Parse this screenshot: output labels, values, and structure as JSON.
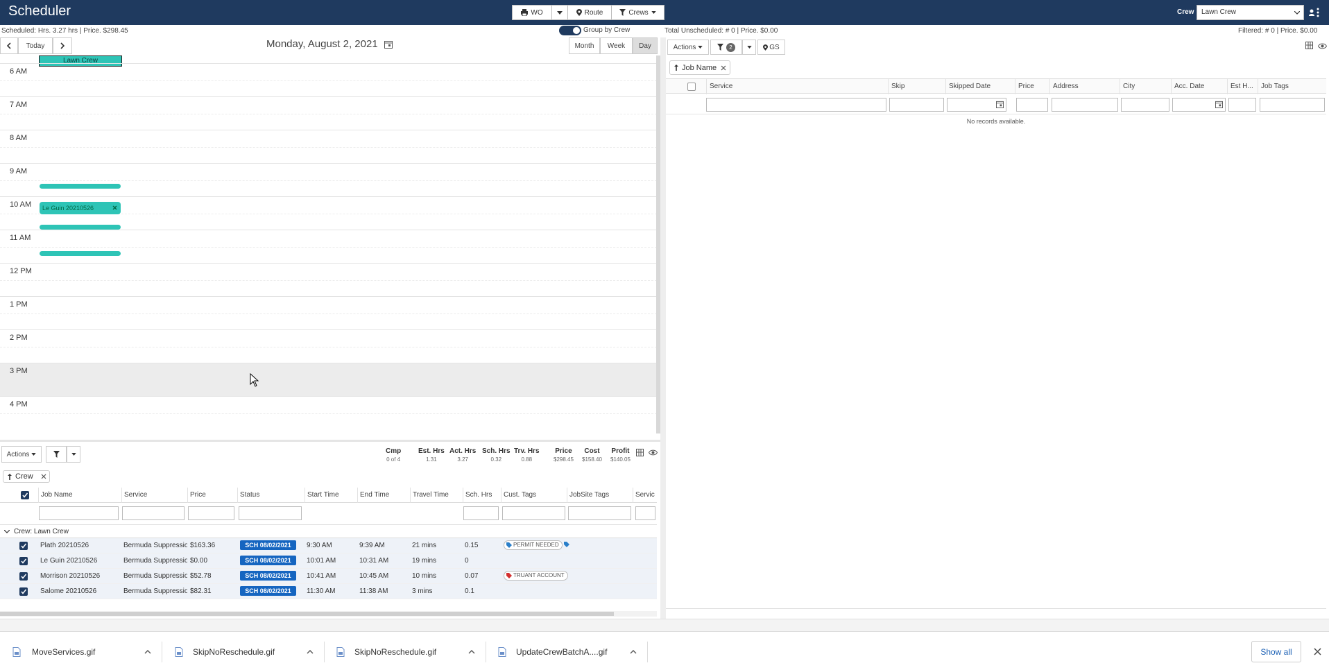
{
  "app_title": "Scheduler",
  "toolbar": {
    "wo": "WO",
    "route": "Route",
    "crews": "Crews",
    "crew_label": "Crew",
    "crew_value": "Lawn Crew"
  },
  "summary_left": "Scheduled:  Hrs. 3.27 hrs   |   Price. $298.45",
  "group_by_crew": "Group by Crew",
  "summary_right_mid": "Total Unscheduled:  # 0   |   Price. $0.00",
  "summary_right_end": "Filtered:  # 0   |   Price. $0.00",
  "calendar": {
    "today": "Today",
    "date": "Monday, August 2, 2021",
    "views": [
      "Month",
      "Week",
      "Day"
    ],
    "crew_header": "Lawn Crew",
    "hours": [
      "6 AM",
      "7 AM",
      "8 AM",
      "9 AM",
      "10 AM",
      "11 AM",
      "12 PM",
      "1 PM",
      "2 PM",
      "3 PM",
      "4 PM"
    ],
    "event_label": "Le Guin 20210526"
  },
  "bottom": {
    "actions": "Actions",
    "stats": [
      {
        "label": "Cmp",
        "value": "0 of 4"
      },
      {
        "label": "Est. Hrs",
        "value": "1.31"
      },
      {
        "label": "Act. Hrs",
        "value": "3.27"
      },
      {
        "label": "Sch. Hrs",
        "value": "0.32"
      },
      {
        "label": "Trv. Hrs",
        "value": "0.88"
      },
      {
        "label": "Price",
        "value": "$298.45"
      },
      {
        "label": "Cost",
        "value": "$158.40"
      },
      {
        "label": "Profit",
        "value": "$140.05"
      }
    ],
    "group_chip": "Crew",
    "columns": [
      "Job Name",
      "Service",
      "Price",
      "Status",
      "Start Time",
      "End Time",
      "Travel Time",
      "Sch. Hrs",
      "Cust. Tags",
      "JobSite Tags",
      "Servic"
    ],
    "group_row": "Crew:  Lawn Crew",
    "rows": [
      {
        "job": "Plath 20210526",
        "service": "Bermuda Suppression",
        "price": "$163.36",
        "status": "SCH 08/02/2021",
        "start": "9:30 AM",
        "end": "9:39 AM",
        "travel": "21 mins",
        "sch": "0.15",
        "tag": "PERMIT NEEDED"
      },
      {
        "job": "Le Guin 20210526",
        "service": "Bermuda Suppression",
        "price": "$0.00",
        "status": "SCH 08/02/2021",
        "start": "10:01 AM",
        "end": "10:31 AM",
        "travel": "19 mins",
        "sch": "0",
        "tag": ""
      },
      {
        "job": "Morrison 20210526",
        "service": "Bermuda Suppression",
        "price": "$52.78",
        "status": "SCH 08/02/2021",
        "start": "10:41 AM",
        "end": "10:45 AM",
        "travel": "10 mins",
        "sch": "0.07",
        "tag": "TRUANT ACCOUNT"
      },
      {
        "job": "Salome 20210526",
        "service": "Bermuda Suppression",
        "price": "$82.31",
        "status": "SCH 08/02/2021",
        "start": "11:30 AM",
        "end": "11:38 AM",
        "travel": "3 mins",
        "sch": "0.1",
        "tag": ""
      }
    ]
  },
  "right": {
    "actions": "Actions",
    "filter_count": "2",
    "gs": "GS",
    "sort_chip": "Job Name",
    "columns": [
      "Service",
      "Skip",
      "Skipped Date",
      "Price",
      "Address",
      "City",
      "Acc. Date",
      "Est H...",
      "Job Tags"
    ],
    "empty": "No records available."
  },
  "downloads": {
    "items": [
      "MoveServices.gif",
      "SkipNoReschedule.gif",
      "SkipNoReschedule.gif",
      "UpdateCrewBatchA....gif"
    ],
    "show_all": "Show all"
  }
}
